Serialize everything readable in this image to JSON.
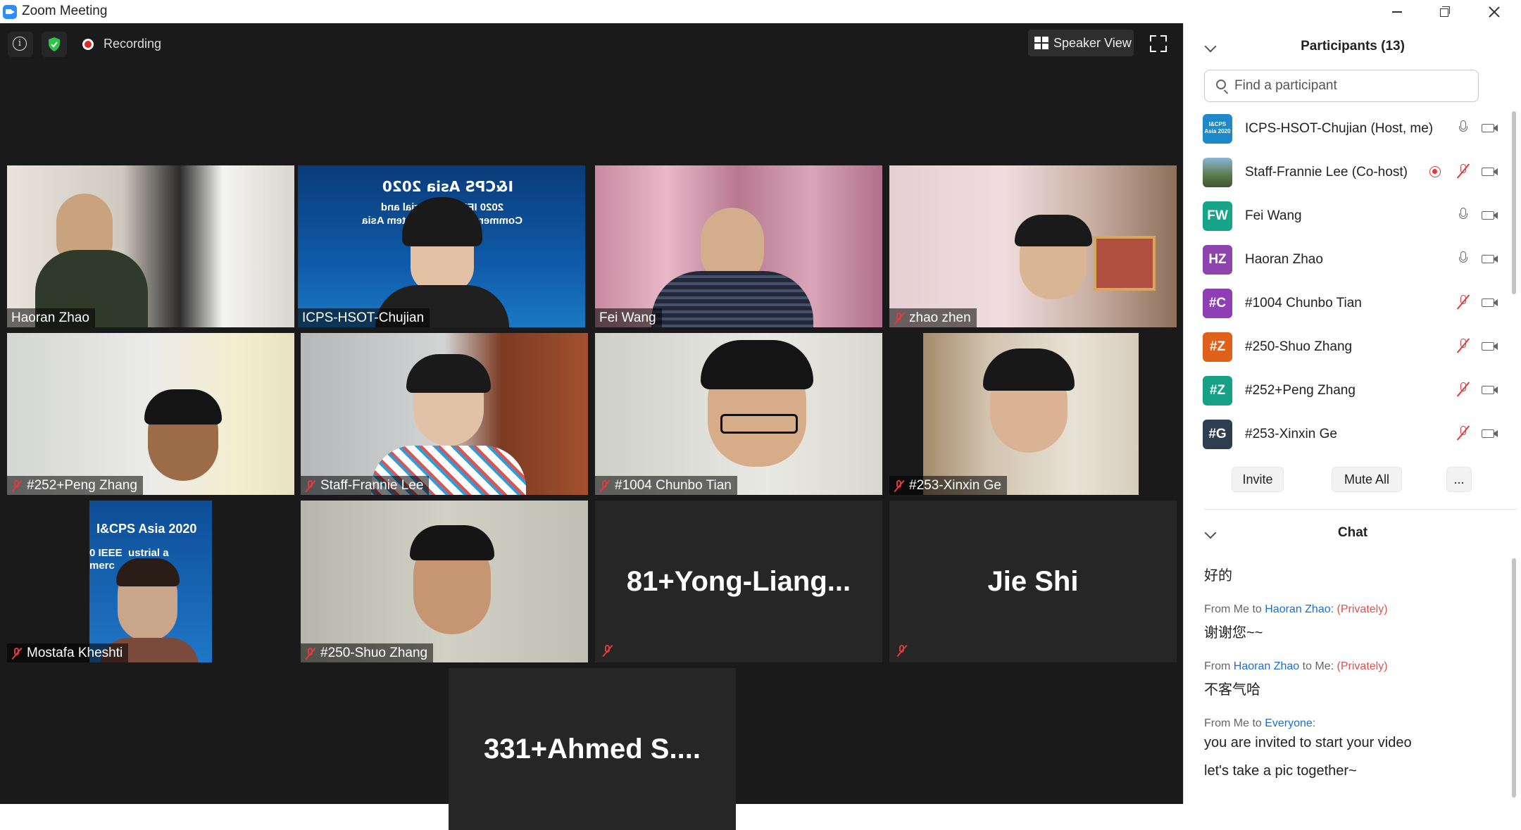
{
  "window": {
    "title": "Zoom Meeting"
  },
  "meeting": {
    "recording_label": "Recording",
    "view_button_label": "Speaker View",
    "tiles": [
      {
        "name": "Haoran Zhao",
        "muted": false
      },
      {
        "name": "ICPS-HSOT-Chujian",
        "muted": false,
        "active_speaker": true,
        "banner_title": "I&CPS Asia 2020",
        "banner_line1": "2020 IEEE Industrial and",
        "banner_line2": "Commercial Power System Asia"
      },
      {
        "name": "Fei Wang",
        "muted": false
      },
      {
        "name": "zhao zhen",
        "muted": true
      },
      {
        "name": "#252+Peng Zhang",
        "muted": true
      },
      {
        "name": "Staff-Frannie Lee",
        "muted": true
      },
      {
        "name": "#1004 Chunbo Tian",
        "muted": true
      },
      {
        "name": "#253-Xinxin Ge",
        "muted": true
      },
      {
        "name": "Mostafa Kheshti",
        "muted": true,
        "banner_title": "I&CPS Asia 2020",
        "banner_line1": "0 IEEE  ustrial a",
        "banner_line2": "merc    System"
      },
      {
        "name": "#250-Shuo Zhang",
        "muted": true
      },
      {
        "name": "81+Yong-Liang...",
        "muted": true,
        "video_off": true
      },
      {
        "name": "Jie Shi",
        "muted": true,
        "video_off": true
      },
      {
        "name": "331+Ahmed  S....",
        "video_off": true
      }
    ]
  },
  "participants": {
    "title": "Participants (13)",
    "search_placeholder": "Find a participant",
    "list": [
      {
        "name": "ICPS-HSOT-Chujian (Host, me)",
        "initials": "I&CPS Asia 2020",
        "avatar_color": "#1e88c8",
        "mic": "on",
        "recording": false
      },
      {
        "name": "Staff-Frannie Lee (Co-host)",
        "initials": "",
        "avatar_color": "#5b7a4a",
        "mic": "off",
        "recording": true
      },
      {
        "name": "Fei Wang",
        "initials": "FW",
        "avatar_color": "#17a589",
        "mic": "on",
        "recording": false
      },
      {
        "name": "Haoran Zhao",
        "initials": "HZ",
        "avatar_color": "#8e44ad",
        "mic": "on",
        "recording": false
      },
      {
        "name": "#1004 Chunbo Tian",
        "initials": "#C",
        "avatar_color": "#8e3fb3",
        "mic": "off",
        "recording": false
      },
      {
        "name": "#250-Shuo Zhang",
        "initials": "#Z",
        "avatar_color": "#e0621a",
        "mic": "off",
        "recording": false
      },
      {
        "name": "#252+Peng Zhang",
        "initials": "#Z",
        "avatar_color": "#16a085",
        "mic": "off",
        "recording": false
      },
      {
        "name": "#253-Xinxin Ge",
        "initials": "#G",
        "avatar_color": "#2c3e50",
        "mic": "off",
        "recording": false
      }
    ],
    "buttons": {
      "invite": "Invite",
      "mute_all": "Mute All",
      "more": "..."
    }
  },
  "chat": {
    "title": "Chat",
    "messages": [
      {
        "text": "好的"
      },
      {
        "from": "From Me to ",
        "who": "Haoran Zhao",
        "suffix": ":",
        "privacy": "(Privately)",
        "text": "谢谢您~~"
      },
      {
        "from": "From ",
        "who": "Haoran Zhao",
        "suffix": " to Me:",
        "privacy": "(Privately)",
        "text": "不客气哈"
      },
      {
        "from": "From Me to ",
        "who": "Everyone",
        "suffix": ":",
        "privacy": "",
        "text": "you are invited to start your video",
        "text2": "let's take a pic together~"
      }
    ]
  }
}
